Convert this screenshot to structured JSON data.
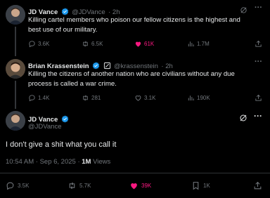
{
  "tweets": [
    {
      "name": "JD Vance",
      "handle": "@JDVance",
      "time": "· 2h",
      "text_line1": "Killing cartel members who poison our fellow citizens is the highest and",
      "text_line2": "best use of our military.",
      "replies": "3.6K",
      "retweets": "6.5K",
      "likes": "61K",
      "views": "1.7M"
    },
    {
      "name": "Brian Krassenstein",
      "handle": "@krassenstein",
      "time": "· 2h",
      "text_line1": "Killing the citizens of another nation who are civilians without any due",
      "text_line2": "process is called a war crime.",
      "replies": "1.4K",
      "retweets": "281",
      "likes": "3.1K",
      "views": "190K"
    }
  ],
  "main": {
    "name": "JD Vance",
    "handle": "@JDVance",
    "text": "I don't give a shit what you call it",
    "timestamp": "10:54 AM · Sep 6, 2025 · ",
    "views_count": "1M",
    "views_label": " Views",
    "replies": "3.5K",
    "retweets": "5.7K",
    "likes": "39K",
    "bookmarks": "1K"
  },
  "colors": {
    "verified": "#1d9bf0",
    "like": "#f91880",
    "muted": "#71767b"
  }
}
